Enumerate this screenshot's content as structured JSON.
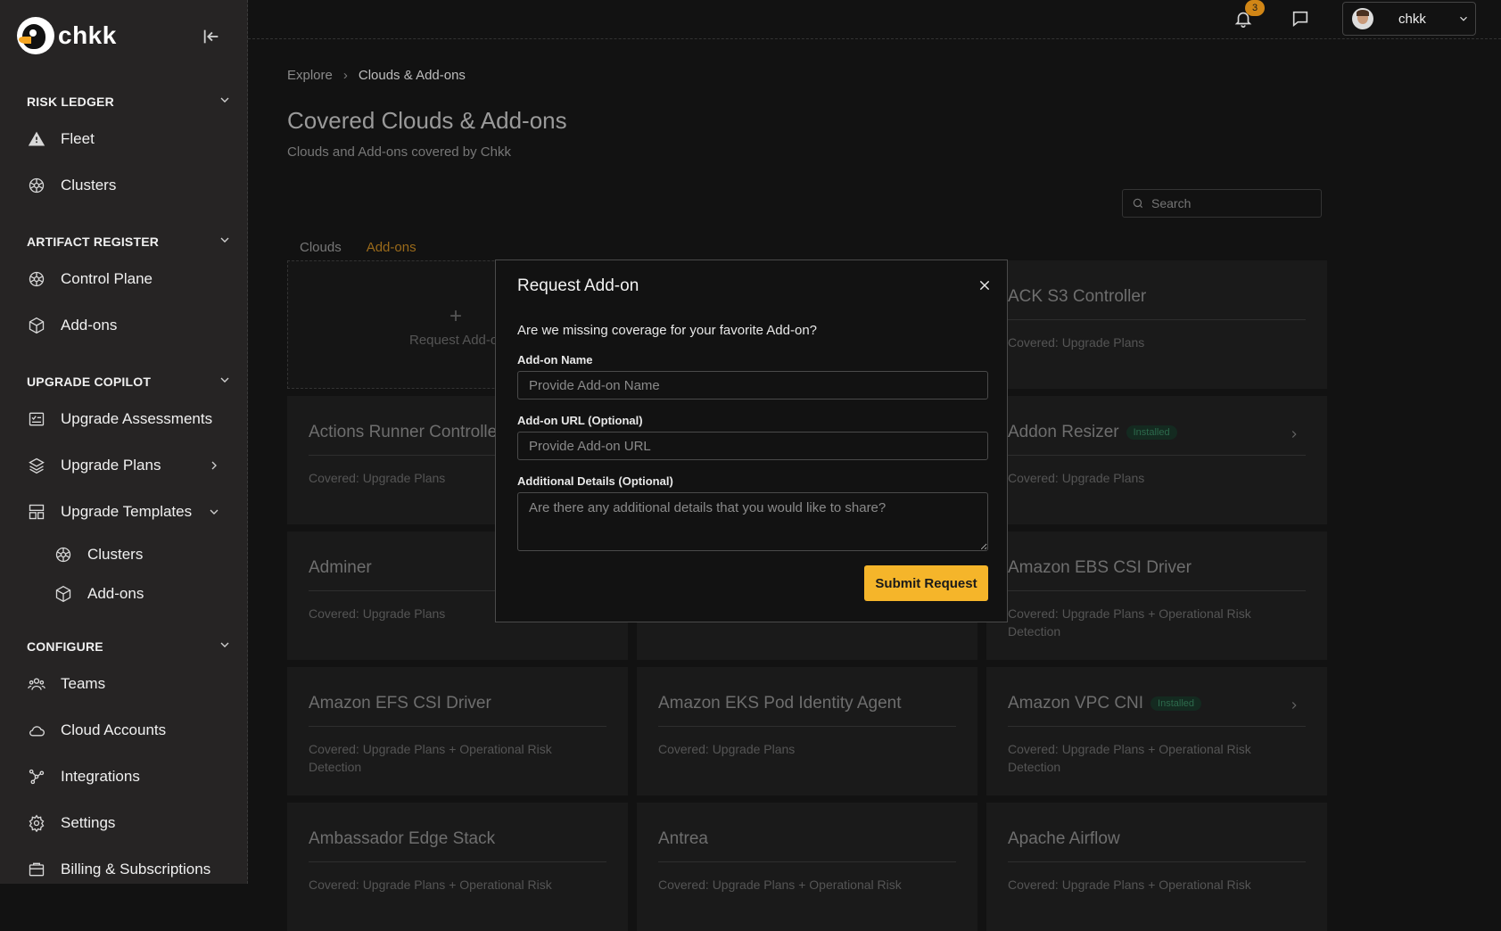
{
  "app": {
    "name": "chkk"
  },
  "sidebar": {
    "sections": [
      {
        "title": "RISK LEDGER",
        "items": [
          {
            "label": "Fleet",
            "icon": "warning-icon"
          },
          {
            "label": "Clusters",
            "icon": "cluster-icon"
          }
        ]
      },
      {
        "title": "ARTIFACT REGISTER",
        "items": [
          {
            "label": "Control Plane",
            "icon": "cluster-icon"
          },
          {
            "label": "Add-ons",
            "icon": "cube-icon"
          }
        ]
      },
      {
        "title": "UPGRADE COPILOT",
        "items": [
          {
            "label": "Upgrade Assessments",
            "icon": "assessment-icon"
          },
          {
            "label": "Upgrade Plans",
            "icon": "layers-icon"
          },
          {
            "label": "Upgrade Templates",
            "icon": "template-icon"
          },
          {
            "label": "Clusters",
            "icon": "cluster-icon"
          },
          {
            "label": "Add-ons",
            "icon": "cube-icon"
          }
        ]
      },
      {
        "title": "CONFIGURE",
        "items": [
          {
            "label": "Teams",
            "icon": "team-icon"
          },
          {
            "label": "Cloud Accounts",
            "icon": "cloud-icon"
          },
          {
            "label": "Integrations",
            "icon": "integrations-icon"
          },
          {
            "label": "Settings",
            "icon": "gear-icon"
          },
          {
            "label": "Billing & Subscriptions",
            "icon": "billing-icon"
          }
        ]
      }
    ]
  },
  "topbar": {
    "notification_count": "3",
    "user_name": "chkk"
  },
  "breadcrumb": {
    "root": "Explore",
    "current": "Clouds & Add-ons"
  },
  "page": {
    "title": "Covered Clouds & Add-ons",
    "subtitle": "Clouds and Add-ons covered by Chkk"
  },
  "search": {
    "placeholder": "Search"
  },
  "tabs": [
    {
      "label": "Clouds"
    },
    {
      "label": "Add-ons"
    }
  ],
  "grid": {
    "request_label": "Request Add-on",
    "cards": [
      {
        "title": "ACK S3 Controller",
        "coverage": "Covered: Upgrade Plans"
      },
      {
        "title": "Actions Runner Controller",
        "coverage": "Covered: Upgrade Plans"
      },
      {
        "title": "Addon Resizer",
        "coverage": "Covered: Upgrade Plans",
        "badge": "Installed"
      },
      {
        "title": "Adminer",
        "coverage": "Covered: Upgrade Plans"
      },
      {
        "title": "Amazon EBS CSI Driver",
        "coverage": "Covered: Upgrade Plans + Operational Risk Detection"
      },
      {
        "title": "Amazon EFS CSI Driver",
        "coverage": "Covered: Upgrade Plans + Operational Risk Detection"
      },
      {
        "title": "Amazon EKS Pod Identity Agent",
        "coverage": "Covered: Upgrade Plans"
      },
      {
        "title": "Amazon VPC CNI",
        "coverage": "Covered: Upgrade Plans + Operational Risk Detection",
        "badge": "Installed"
      },
      {
        "title": "Ambassador Edge Stack",
        "coverage": "Covered: Upgrade Plans + Operational Risk"
      },
      {
        "title": "Antrea",
        "coverage": "Covered: Upgrade Plans + Operational Risk"
      },
      {
        "title": "Apache Airflow",
        "coverage": "Covered: Upgrade Plans + Operational Risk"
      }
    ]
  },
  "modal": {
    "title": "Request Add-on",
    "question": "Are we missing coverage for your favorite Add-on?",
    "name_label": "Add-on Name",
    "name_placeholder": "Provide Add-on Name",
    "url_label": "Add-on URL (Optional)",
    "url_placeholder": "Provide Add-on URL",
    "details_label": "Additional Details (Optional)",
    "details_placeholder": "Are there any additional details that you would like to share?",
    "submit_label": "Submit Request"
  }
}
